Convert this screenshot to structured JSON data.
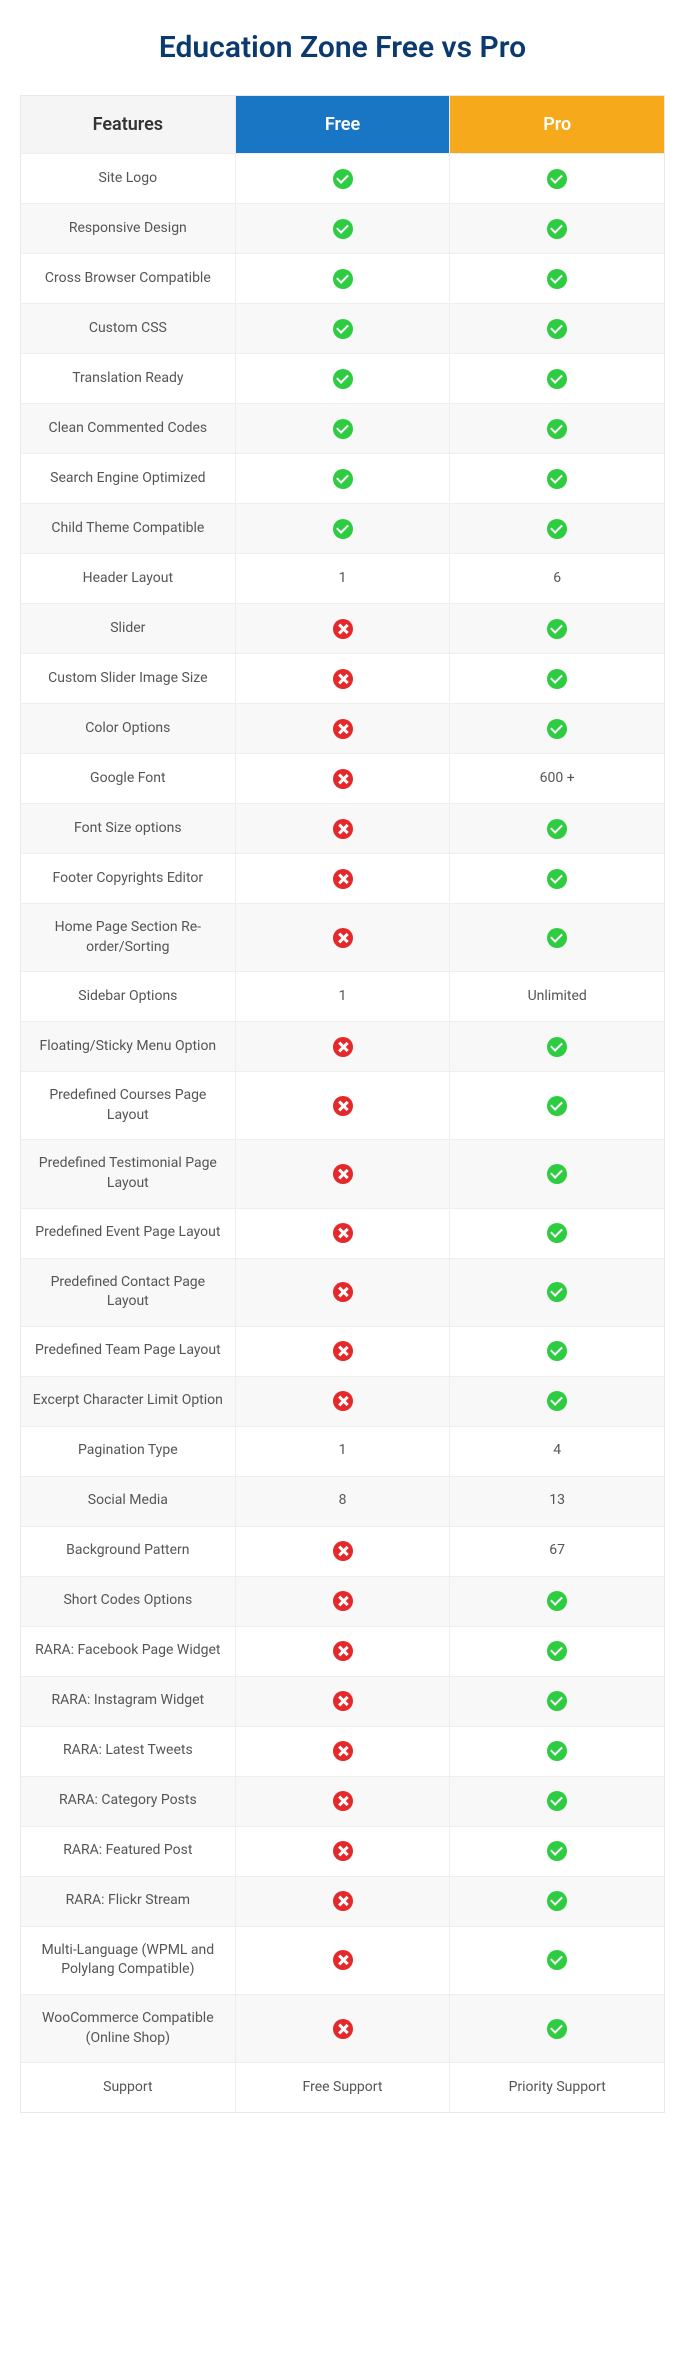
{
  "title": "Education Zone Free vs Pro",
  "headers": {
    "features": "Features",
    "free": "Free",
    "pro": "Pro"
  },
  "icons": {
    "check": "check",
    "cross": "cross"
  },
  "rows": [
    {
      "feature": "Site Logo",
      "free_type": "check",
      "pro_type": "check"
    },
    {
      "feature": "Responsive Design",
      "free_type": "check",
      "pro_type": "check"
    },
    {
      "feature": "Cross Browser Compatible",
      "free_type": "check",
      "pro_type": "check"
    },
    {
      "feature": "Custom CSS",
      "free_type": "check",
      "pro_type": "check"
    },
    {
      "feature": "Translation Ready",
      "free_type": "check",
      "pro_type": "check"
    },
    {
      "feature": "Clean Commented Codes",
      "free_type": "check",
      "pro_type": "check"
    },
    {
      "feature": "Search Engine Optimized",
      "free_type": "check",
      "pro_type": "check"
    },
    {
      "feature": "Child Theme Compatible",
      "free_type": "check",
      "pro_type": "check"
    },
    {
      "feature": "Header Layout",
      "free_type": "text",
      "free_text": "1",
      "pro_type": "text",
      "pro_text": "6"
    },
    {
      "feature": "Slider",
      "free_type": "cross",
      "pro_type": "check"
    },
    {
      "feature": "Custom Slider Image Size",
      "free_type": "cross",
      "pro_type": "check"
    },
    {
      "feature": "Color Options",
      "free_type": "cross",
      "pro_type": "check"
    },
    {
      "feature": "Google Font",
      "free_type": "cross",
      "pro_type": "text",
      "pro_text": "600 +"
    },
    {
      "feature": "Font Size options",
      "free_type": "cross",
      "pro_type": "check"
    },
    {
      "feature": "Footer Copyrights Editor",
      "free_type": "cross",
      "pro_type": "check"
    },
    {
      "feature": "Home Page Section Re-order/Sorting",
      "free_type": "cross",
      "pro_type": "check"
    },
    {
      "feature": "Sidebar Options",
      "free_type": "text",
      "free_text": "1",
      "pro_type": "text",
      "pro_text": "Unlimited"
    },
    {
      "feature": "Floating/Sticky Menu Option",
      "free_type": "cross",
      "pro_type": "check"
    },
    {
      "feature": "Predefined Courses Page Layout",
      "free_type": "cross",
      "pro_type": "check"
    },
    {
      "feature": "Predefined Testimonial Page Layout",
      "free_type": "cross",
      "pro_type": "check"
    },
    {
      "feature": "Predefined Event Page Layout",
      "free_type": "cross",
      "pro_type": "check"
    },
    {
      "feature": "Predefined Contact Page Layout",
      "free_type": "cross",
      "pro_type": "check"
    },
    {
      "feature": "Predefined Team Page Layout",
      "free_type": "cross",
      "pro_type": "check"
    },
    {
      "feature": "Excerpt Character Limit Option",
      "free_type": "cross",
      "pro_type": "check"
    },
    {
      "feature": "Pagination Type",
      "free_type": "text",
      "free_text": "1",
      "pro_type": "text",
      "pro_text": "4"
    },
    {
      "feature": "Social Media",
      "free_type": "text",
      "free_text": "8",
      "pro_type": "text",
      "pro_text": "13"
    },
    {
      "feature": "Background Pattern",
      "free_type": "cross",
      "pro_type": "text",
      "pro_text": "67"
    },
    {
      "feature": "Short Codes Options",
      "free_type": "cross",
      "pro_type": "check"
    },
    {
      "feature": "RARA: Facebook Page Widget",
      "free_type": "cross",
      "pro_type": "check"
    },
    {
      "feature": "RARA: Instagram Widget",
      "free_type": "cross",
      "pro_type": "check"
    },
    {
      "feature": "RARA: Latest Tweets",
      "free_type": "cross",
      "pro_type": "check"
    },
    {
      "feature": "RARA: Category Posts",
      "free_type": "cross",
      "pro_type": "check"
    },
    {
      "feature": "RARA: Featured Post",
      "free_type": "cross",
      "pro_type": "check"
    },
    {
      "feature": "RARA: Flickr Stream",
      "free_type": "cross",
      "pro_type": "check"
    },
    {
      "feature": "Multi-Language (WPML and Polylang Compatible)",
      "free_type": "cross",
      "pro_type": "check"
    },
    {
      "feature": "WooCommerce Compatible (Online Shop)",
      "free_type": "cross",
      "pro_type": "check"
    },
    {
      "feature": "Support",
      "free_type": "text",
      "free_text": "Free Support",
      "pro_type": "text",
      "pro_text": "Priority Support"
    }
  ]
}
